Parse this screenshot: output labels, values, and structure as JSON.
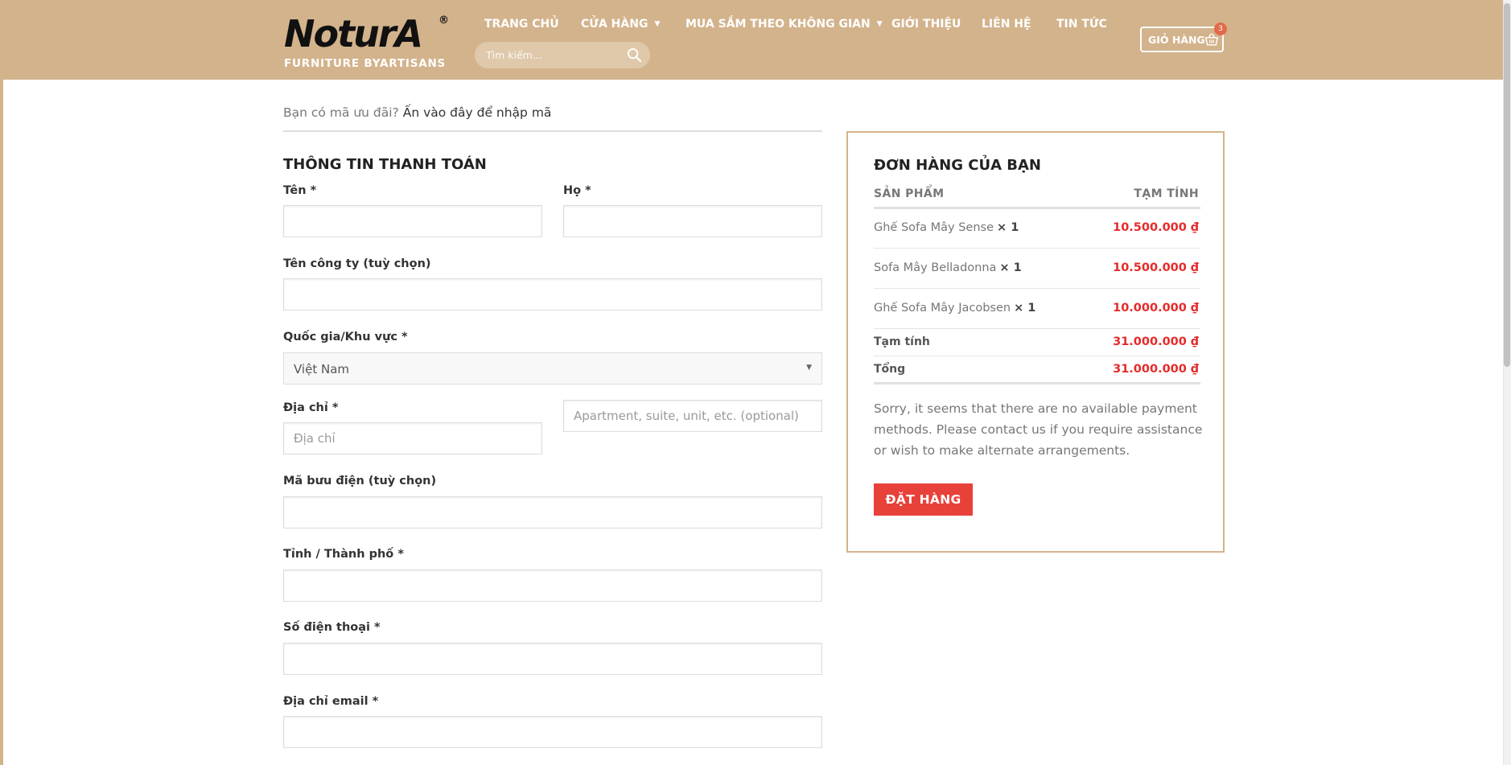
{
  "brand": {
    "logo_text": "NoturA",
    "registered": "®",
    "tagline": "FURNITURE BYARTISANS"
  },
  "nav": {
    "items": [
      {
        "label": "TRANG CHỦ",
        "has_dropdown": false
      },
      {
        "label": "CỬA HÀNG",
        "has_dropdown": true
      },
      {
        "label": "MUA SẮM THEO KHÔNG GIAN",
        "has_dropdown": true
      },
      {
        "label": "GIỚI THIỆU",
        "has_dropdown": false
      },
      {
        "label": "LIÊN HỆ",
        "has_dropdown": false
      },
      {
        "label": "TIN TỨC",
        "has_dropdown": false
      }
    ],
    "caret": "▼"
  },
  "search": {
    "placeholder": "Tìm kiếm...",
    "icon": "search-icon"
  },
  "cart": {
    "label": "GIỎ HÀNG",
    "count": "3",
    "icon": "basket-icon"
  },
  "coupon": {
    "prompt": "Bạn có mã ưu đãi?",
    "link": "Ấn vào đây để nhập mã"
  },
  "billing": {
    "title": "THÔNG TIN THANH TOÁN",
    "first_name": {
      "label": "Tên",
      "required": "*",
      "value": ""
    },
    "last_name": {
      "label": "Họ",
      "required": "*",
      "value": ""
    },
    "company": {
      "label": "Tên công ty (tuỳ chọn)",
      "value": ""
    },
    "country": {
      "label": "Quốc gia/Khu vực",
      "required": "*",
      "value": "Việt Nam"
    },
    "address": {
      "label": "Địa chỉ",
      "required": "*",
      "placeholder": "Địa chỉ",
      "placeholder2": "Apartment, suite, unit, etc. (optional)"
    },
    "postcode": {
      "label": "Mã bưu điện (tuỳ chọn)",
      "value": ""
    },
    "city": {
      "label": "Tỉnh / Thành phố",
      "required": "*",
      "value": ""
    },
    "phone": {
      "label": "Số điện thoại",
      "required": "*",
      "value": ""
    },
    "email": {
      "label": "Địa chỉ email",
      "required": "*",
      "value": ""
    }
  },
  "order": {
    "title": "ĐƠN HÀNG CỦA BẠN",
    "col_product": "SẢN PHẨM",
    "col_subtotal": "TẠM TÍNH",
    "items": [
      {
        "name": "Ghế Sofa Mây Sense",
        "qty": "× 1",
        "price": "10.500.000 ₫"
      },
      {
        "name": "Sofa Mây Belladonna",
        "qty": "× 1",
        "price": "10.500.000 ₫"
      },
      {
        "name": "Ghế Sofa Mây Jacobsen",
        "qty": "× 1",
        "price": "10.000.000 ₫"
      }
    ],
    "subtotal_label": "Tạm tính",
    "subtotal_value": "31.000.000 ₫",
    "total_label": "Tổng",
    "total_value": "31.000.000 ₫",
    "notice": "Sorry, it seems that there are no available payment methods. Please contact us if you require assistance or wish to make alternate arrangements.",
    "place_order": "ĐẶT HÀNG"
  },
  "colors": {
    "header_bg": "#d3b38c",
    "accent_red": "#e8413a",
    "price_red": "#e52b2b",
    "order_border": "#d3b38c"
  }
}
